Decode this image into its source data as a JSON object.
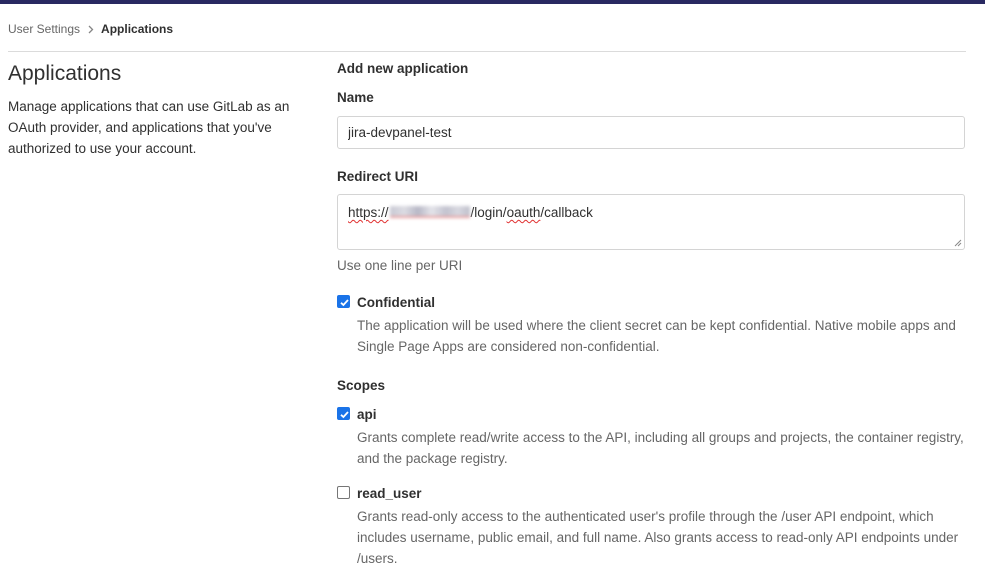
{
  "breadcrumb": {
    "parent": "User Settings",
    "current": "Applications"
  },
  "left": {
    "title": "Applications",
    "description": "Manage applications that can use GitLab as an OAuth provider, and applications that you've authorized to use your account."
  },
  "form": {
    "section_title": "Add new application",
    "name_label": "Name",
    "name_value": "jira-devpanel-test",
    "redirect_label": "Redirect URI",
    "redirect_prefix": "https://",
    "redirect_mid": "/login/",
    "redirect_oauth": "oauth",
    "redirect_suffix": "/callback",
    "redirect_help": "Use one line per URI",
    "confidential": {
      "label": "Confidential",
      "checked": true,
      "description": "The application will be used where the client secret can be kept confidential. Native mobile apps and Single Page Apps are considered non-confidential."
    },
    "scopes_label": "Scopes",
    "scopes": [
      {
        "label": "api",
        "checked": true,
        "description": "Grants complete read/write access to the API, including all groups and projects, the container registry, and the package registry."
      },
      {
        "label": "read_user",
        "checked": false,
        "description": "Grants read-only access to the authenticated user's profile through the /user API endpoint, which includes username, public email, and full name. Also grants access to read-only API endpoints under /users."
      }
    ]
  },
  "colors": {
    "topbar": "#292961",
    "checkbox": "#1a73e8"
  }
}
